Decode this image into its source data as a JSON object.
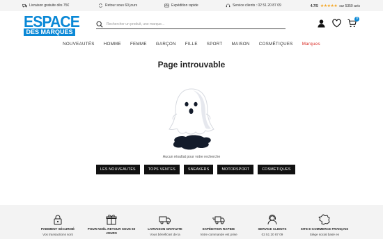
{
  "topbar": {
    "delivery": "Livraison gratuite dès 75€",
    "returns": "Retour sous 60 jours",
    "shipping": "Expédition rapide",
    "service": "Service clients : 02 51 20 87 09",
    "rating_score": "4.7/5",
    "rating_suffix": "sur 5350 avis"
  },
  "logo": {
    "line1": "ESPACE",
    "line2": "DES MARQUES"
  },
  "search": {
    "placeholder": "Rechercher un produit, une marque..."
  },
  "cart": {
    "count": "0"
  },
  "nav": [
    "NOUVEAUTÉS",
    "HOMME",
    "FEMME",
    "GARÇON",
    "FILLE",
    "SPORT",
    "MAISON",
    "COSMÉTIQUES",
    "Marques"
  ],
  "page": {
    "title": "Page introuvable",
    "no_result": "Aucun résultat pour votre recherche"
  },
  "categories": [
    "LES NOUVEAUTÉS",
    "TOPS VENTES",
    "SNEAKERS",
    "MOTORSPORT",
    "COSMÉTIQUES"
  ],
  "features": [
    {
      "icon": "lock-icon",
      "title": "PAIEMENT SÉCURISÉ",
      "subtitle": "Vos transactions sont"
    },
    {
      "icon": "gift-icon",
      "title": "POUR NOËL RETOUR SOUS 60 JOURS",
      "subtitle": ""
    },
    {
      "icon": "truck-icon",
      "title": "LIVRAISON GRATUITE",
      "subtitle": "Vous bénéficiez de la"
    },
    {
      "icon": "fast-truck-icon",
      "title": "EXPÉDITION RAPIDE",
      "subtitle": "Votre commande est prise"
    },
    {
      "icon": "headset-icon",
      "title": "SERVICE CLIENTS",
      "subtitle": "02 51 20 87 09"
    },
    {
      "icon": "france-map-icon",
      "title": "SITE E-COMMERCE FRANÇAIS",
      "subtitle": "Siège social basé en"
    }
  ],
  "colors": {
    "brand_blue": "#0a88d6",
    "brands_red": "#d8261f",
    "button_black": "#111111"
  }
}
